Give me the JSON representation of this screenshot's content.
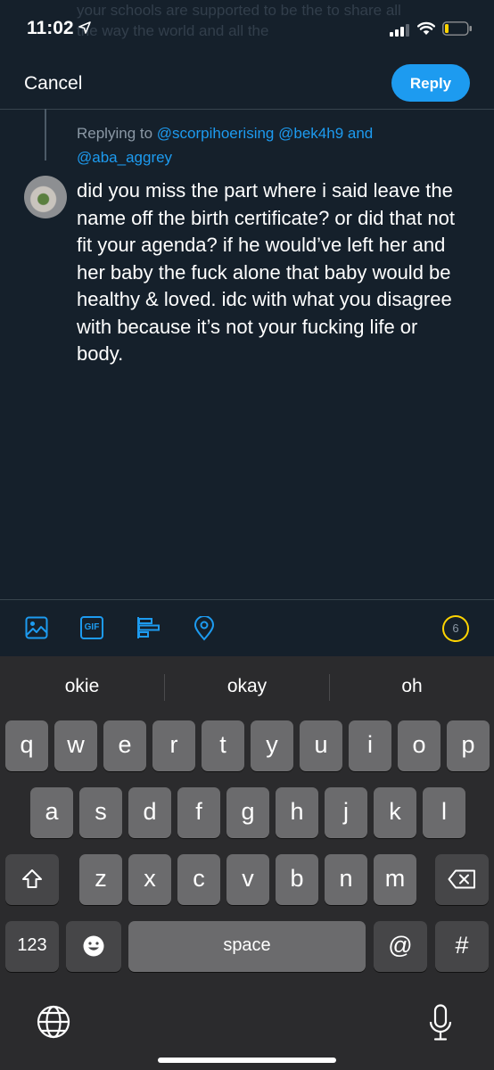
{
  "status": {
    "time": "11:02",
    "ghost_text": "your schools are supported to be the to share all the way the world and all the"
  },
  "header": {
    "cancel_label": "Cancel",
    "reply_label": "Reply"
  },
  "reply_context": {
    "prefix": "Replying to",
    "mention1": "@scorpihoerising",
    "mention2": "@bek4h9",
    "conj": "and",
    "mention3": "@aba_aggrey"
  },
  "tweet": {
    "text": "did you miss the part where i said leave the name off the birth certificate? or did that not fit your agenda? if he would’ve left her and her baby the fuck alone that baby would be healthy & loved. idc with what you disagree with because it’s not your fucking life or body."
  },
  "toolbar": {
    "icons": [
      "image-icon",
      "gif-icon",
      "poll-icon",
      "location-icon"
    ],
    "gif_label": "GIF",
    "char_count": "6",
    "accent": "#1d9bf0",
    "ring_color": "#ffd400"
  },
  "keyboard": {
    "suggestions": [
      "okie",
      "okay",
      "oh"
    ],
    "row1": [
      "q",
      "w",
      "e",
      "r",
      "t",
      "y",
      "u",
      "i",
      "o",
      "p"
    ],
    "row2": [
      "a",
      "s",
      "d",
      "f",
      "g",
      "h",
      "j",
      "k",
      "l"
    ],
    "row3": [
      "z",
      "x",
      "c",
      "v",
      "b",
      "n",
      "m"
    ],
    "numbers_label": "123",
    "space_label": "space",
    "at_label": "@",
    "hash_label": "#"
  }
}
